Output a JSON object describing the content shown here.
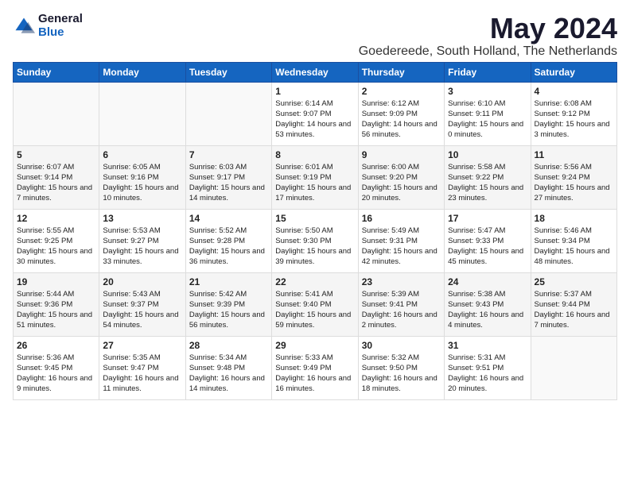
{
  "logo": {
    "general": "General",
    "blue": "Blue"
  },
  "title": "May 2024",
  "subtitle": "Goedereede, South Holland, The Netherlands",
  "days_of_week": [
    "Sunday",
    "Monday",
    "Tuesday",
    "Wednesday",
    "Thursday",
    "Friday",
    "Saturday"
  ],
  "weeks": [
    [
      {
        "day": "",
        "content": ""
      },
      {
        "day": "",
        "content": ""
      },
      {
        "day": "",
        "content": ""
      },
      {
        "day": "1",
        "content": "Sunrise: 6:14 AM\nSunset: 9:07 PM\nDaylight: 14 hours and 53 minutes."
      },
      {
        "day": "2",
        "content": "Sunrise: 6:12 AM\nSunset: 9:09 PM\nDaylight: 14 hours and 56 minutes."
      },
      {
        "day": "3",
        "content": "Sunrise: 6:10 AM\nSunset: 9:11 PM\nDaylight: 15 hours and 0 minutes."
      },
      {
        "day": "4",
        "content": "Sunrise: 6:08 AM\nSunset: 9:12 PM\nDaylight: 15 hours and 3 minutes."
      }
    ],
    [
      {
        "day": "5",
        "content": "Sunrise: 6:07 AM\nSunset: 9:14 PM\nDaylight: 15 hours and 7 minutes."
      },
      {
        "day": "6",
        "content": "Sunrise: 6:05 AM\nSunset: 9:16 PM\nDaylight: 15 hours and 10 minutes."
      },
      {
        "day": "7",
        "content": "Sunrise: 6:03 AM\nSunset: 9:17 PM\nDaylight: 15 hours and 14 minutes."
      },
      {
        "day": "8",
        "content": "Sunrise: 6:01 AM\nSunset: 9:19 PM\nDaylight: 15 hours and 17 minutes."
      },
      {
        "day": "9",
        "content": "Sunrise: 6:00 AM\nSunset: 9:20 PM\nDaylight: 15 hours and 20 minutes."
      },
      {
        "day": "10",
        "content": "Sunrise: 5:58 AM\nSunset: 9:22 PM\nDaylight: 15 hours and 23 minutes."
      },
      {
        "day": "11",
        "content": "Sunrise: 5:56 AM\nSunset: 9:24 PM\nDaylight: 15 hours and 27 minutes."
      }
    ],
    [
      {
        "day": "12",
        "content": "Sunrise: 5:55 AM\nSunset: 9:25 PM\nDaylight: 15 hours and 30 minutes."
      },
      {
        "day": "13",
        "content": "Sunrise: 5:53 AM\nSunset: 9:27 PM\nDaylight: 15 hours and 33 minutes."
      },
      {
        "day": "14",
        "content": "Sunrise: 5:52 AM\nSunset: 9:28 PM\nDaylight: 15 hours and 36 minutes."
      },
      {
        "day": "15",
        "content": "Sunrise: 5:50 AM\nSunset: 9:30 PM\nDaylight: 15 hours and 39 minutes."
      },
      {
        "day": "16",
        "content": "Sunrise: 5:49 AM\nSunset: 9:31 PM\nDaylight: 15 hours and 42 minutes."
      },
      {
        "day": "17",
        "content": "Sunrise: 5:47 AM\nSunset: 9:33 PM\nDaylight: 15 hours and 45 minutes."
      },
      {
        "day": "18",
        "content": "Sunrise: 5:46 AM\nSunset: 9:34 PM\nDaylight: 15 hours and 48 minutes."
      }
    ],
    [
      {
        "day": "19",
        "content": "Sunrise: 5:44 AM\nSunset: 9:36 PM\nDaylight: 15 hours and 51 minutes."
      },
      {
        "day": "20",
        "content": "Sunrise: 5:43 AM\nSunset: 9:37 PM\nDaylight: 15 hours and 54 minutes."
      },
      {
        "day": "21",
        "content": "Sunrise: 5:42 AM\nSunset: 9:39 PM\nDaylight: 15 hours and 56 minutes."
      },
      {
        "day": "22",
        "content": "Sunrise: 5:41 AM\nSunset: 9:40 PM\nDaylight: 15 hours and 59 minutes."
      },
      {
        "day": "23",
        "content": "Sunrise: 5:39 AM\nSunset: 9:41 PM\nDaylight: 16 hours and 2 minutes."
      },
      {
        "day": "24",
        "content": "Sunrise: 5:38 AM\nSunset: 9:43 PM\nDaylight: 16 hours and 4 minutes."
      },
      {
        "day": "25",
        "content": "Sunrise: 5:37 AM\nSunset: 9:44 PM\nDaylight: 16 hours and 7 minutes."
      }
    ],
    [
      {
        "day": "26",
        "content": "Sunrise: 5:36 AM\nSunset: 9:45 PM\nDaylight: 16 hours and 9 minutes."
      },
      {
        "day": "27",
        "content": "Sunrise: 5:35 AM\nSunset: 9:47 PM\nDaylight: 16 hours and 11 minutes."
      },
      {
        "day": "28",
        "content": "Sunrise: 5:34 AM\nSunset: 9:48 PM\nDaylight: 16 hours and 14 minutes."
      },
      {
        "day": "29",
        "content": "Sunrise: 5:33 AM\nSunset: 9:49 PM\nDaylight: 16 hours and 16 minutes."
      },
      {
        "day": "30",
        "content": "Sunrise: 5:32 AM\nSunset: 9:50 PM\nDaylight: 16 hours and 18 minutes."
      },
      {
        "day": "31",
        "content": "Sunrise: 5:31 AM\nSunset: 9:51 PM\nDaylight: 16 hours and 20 minutes."
      },
      {
        "day": "",
        "content": ""
      }
    ]
  ]
}
